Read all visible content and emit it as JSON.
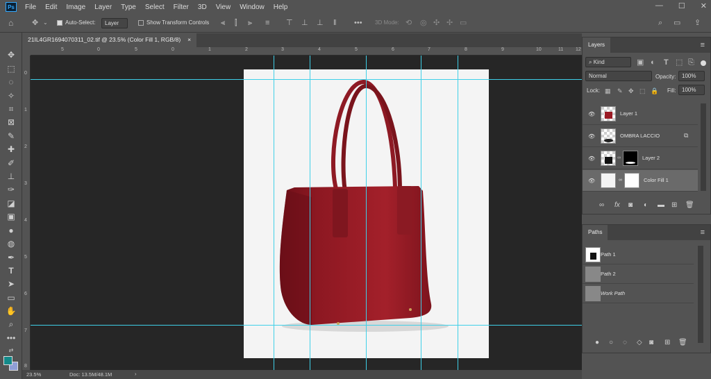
{
  "app": {
    "logo": "Ps"
  },
  "menu": [
    "File",
    "Edit",
    "Image",
    "Layer",
    "Type",
    "Select",
    "Filter",
    "3D",
    "View",
    "Window",
    "Help"
  ],
  "window_controls": [
    "—",
    "☐",
    "✕"
  ],
  "options": {
    "auto_select_label": "Auto-Select:",
    "auto_select_value": "Layer",
    "transform_controls_label": "Show Transform Controls",
    "mode_3d_label": "3D Mode:"
  },
  "document": {
    "tab_title": "21IL4GR1694070311_02.tif @ 23.5% (Color Fill 1, RGB/8)",
    "tab_close": "×"
  },
  "status": {
    "zoom": "23.5%",
    "doc_size": "Doc: 13.5M/48.1M",
    "arrow": "›"
  },
  "ruler": {
    "h_labels": [
      "5",
      "0",
      "5",
      "0",
      "1",
      "2",
      "3",
      "4",
      "5",
      "6",
      "7",
      "8",
      "9",
      "10",
      "11",
      "12"
    ],
    "v_labels": [
      "0",
      "1",
      "2",
      "3",
      "4",
      "5",
      "6",
      "7",
      "8"
    ]
  },
  "layers_panel": {
    "title": "Layers",
    "filter_kind": "Kind",
    "blend_mode": "Normal",
    "opacity_label": "Opacity:",
    "opacity_value": "100%",
    "lock_label": "Lock:",
    "fill_label": "Fill:",
    "fill_value": "100%",
    "layers": [
      {
        "name": "Layer 1"
      },
      {
        "name": "OMBRA LACCIO"
      },
      {
        "name": "Layer 2"
      },
      {
        "name": "Color Fill 1"
      }
    ]
  },
  "paths_panel": {
    "title": "Paths",
    "paths": [
      {
        "name": "Path 1"
      },
      {
        "name": "Path 2"
      },
      {
        "name": "Work Path"
      }
    ]
  },
  "colors": {
    "guide": "#3fd0e8",
    "bag": "#9b1b25",
    "foreground": "#138a8a",
    "background": "#8f9ed6"
  }
}
